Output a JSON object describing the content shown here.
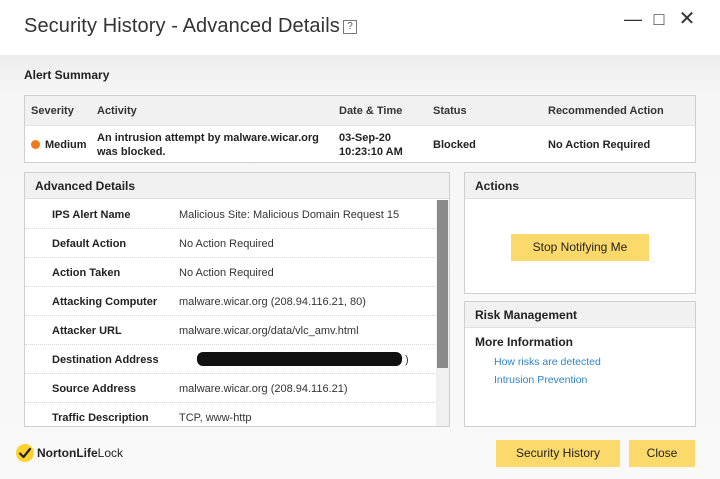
{
  "window": {
    "title": "Security History - Advanced Details",
    "help_glyph": "?",
    "minimize_glyph": "—",
    "maximize_glyph": "□",
    "close_glyph": "✕"
  },
  "alert_summary": {
    "title": "Alert Summary",
    "columns": [
      "Severity",
      "Activity",
      "Date & Time",
      "Status",
      "Recommended Action"
    ],
    "row": {
      "severity": "Medium",
      "activity_line1": "An intrusion attempt by malware.wicar.org",
      "activity_line2": "was blocked.",
      "date": "03-Sep-20",
      "time": "10:23:10 AM",
      "status": "Blocked",
      "recommended_action": "No Action Required"
    },
    "severity_color": "#f07a1a"
  },
  "advanced_details": {
    "title": "Advanced Details",
    "rows": [
      {
        "label": "IPS Alert Name",
        "value": "Malicious Site: Malicious Domain Request 15"
      },
      {
        "label": "Default Action",
        "value": "No Action Required"
      },
      {
        "label": "Action Taken",
        "value": "No Action Required"
      },
      {
        "label": "Attacking Computer",
        "value": "malware.wicar.org (208.94.116.21, 80)"
      },
      {
        "label": "Attacker URL",
        "value": "malware.wicar.org/data/vlc_amv.html"
      },
      {
        "label": "Destination Address",
        "value": ")"
      },
      {
        "label": "Source Address",
        "value": "malware.wicar.org (208.94.116.21)"
      },
      {
        "label": "Traffic Description",
        "value": "TCP, www-http"
      }
    ]
  },
  "actions": {
    "title": "Actions",
    "stop_notifying_label": "Stop Notifying Me"
  },
  "risk_management": {
    "title": "Risk Management",
    "more_info": "More Information",
    "links": [
      "How risks are detected",
      "Intrusion Prevention"
    ]
  },
  "footer": {
    "logo_bold": "NortonLife",
    "logo_light": "Lock",
    "logo_check": "✓",
    "security_history_label": "Security History",
    "close_label": "Close"
  },
  "colors": {
    "accent_button": "#fcd96b",
    "link": "#2f86c9",
    "logo_yellow": "#fcd22f"
  }
}
